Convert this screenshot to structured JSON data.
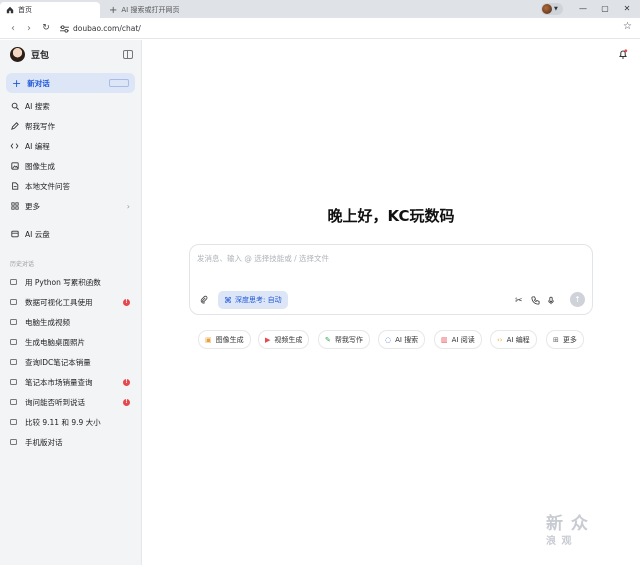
{
  "browser": {
    "active_tab": "首页",
    "new_tab": "AI 搜索或打开网页",
    "url": "doubao.com/chat/"
  },
  "sidebar": {
    "brand": "豆包",
    "new_chat": "新对话",
    "items": [
      {
        "label": "AI 搜索",
        "icon": "search-icon"
      },
      {
        "label": "帮我写作",
        "icon": "pen-icon"
      },
      {
        "label": "AI 编程",
        "icon": "code-icon"
      },
      {
        "label": "图像生成",
        "icon": "image-icon"
      },
      {
        "label": "本地文件问答",
        "icon": "file-icon"
      },
      {
        "label": "更多",
        "icon": "grid-icon"
      }
    ],
    "cloud": "AI 云盘",
    "history_label": "历史对话",
    "history": [
      {
        "label": "用 Python 写累积函数",
        "badge": ""
      },
      {
        "label": "数据可视化工具使用",
        "badge": "!"
      },
      {
        "label": "电脑生成视频",
        "badge": ""
      },
      {
        "label": "生成电脑桌面照片",
        "badge": ""
      },
      {
        "label": "查询IDC笔记本销量",
        "badge": ""
      },
      {
        "label": "笔记本市场销量查询",
        "badge": "!"
      },
      {
        "label": "询问能否听到说话",
        "badge": "!"
      },
      {
        "label": "比较 9.11 和 9.9 大小",
        "badge": ""
      },
      {
        "label": "手机版对话",
        "badge": ""
      }
    ]
  },
  "main": {
    "greeting": "晚上好，KC玩数码",
    "input_placeholder": "发消息、输入 @ 选择技能或 / 选择文件",
    "deep_think": "深度思考: 自动",
    "chips": [
      {
        "label": "图像生成",
        "color": "#e8a23a"
      },
      {
        "label": "视频生成",
        "color": "#e5484d"
      },
      {
        "label": "帮我写作",
        "color": "#2fa84f"
      },
      {
        "label": "AI 搜索",
        "color": "#1f57d8"
      },
      {
        "label": "AI 阅读",
        "color": "#e5484d"
      },
      {
        "label": "AI 编程",
        "color": "#e8a23a"
      },
      {
        "label": "更多",
        "color": "#666666"
      }
    ]
  },
  "watermark": {
    "line1": "新 众",
    "line2": "浪 观"
  },
  "colors": {
    "accent": "#1f57d8",
    "accent_bg": "#dce6f7",
    "sidebar_bg": "#f3f4f6",
    "badge": "#e5484d"
  }
}
